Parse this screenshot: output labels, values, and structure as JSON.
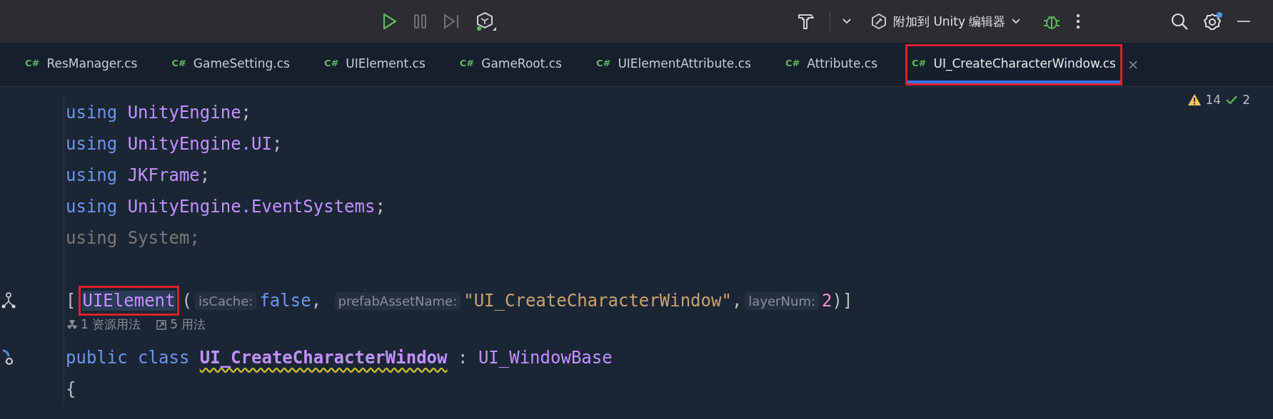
{
  "toolbar": {
    "attach_button": {
      "label": "附加到 Unity 编辑器"
    }
  },
  "tabs": [
    {
      "lang": "C#",
      "label": "ResManager.cs",
      "selected": false,
      "highlighted": false
    },
    {
      "lang": "C#",
      "label": "GameSetting.cs",
      "selected": false,
      "highlighted": false
    },
    {
      "lang": "C#",
      "label": "UIElement.cs",
      "selected": false,
      "highlighted": false
    },
    {
      "lang": "C#",
      "label": "GameRoot.cs",
      "selected": false,
      "highlighted": false
    },
    {
      "lang": "C#",
      "label": "UIElementAttribute.cs",
      "selected": false,
      "highlighted": false
    },
    {
      "lang": "C#",
      "label": "Attribute.cs",
      "selected": false,
      "highlighted": false
    },
    {
      "lang": "C#",
      "label": "UI_CreateCharacterWindow.cs",
      "selected": true,
      "highlighted": true
    }
  ],
  "inspections": {
    "warnings": "14",
    "passed": "2"
  },
  "lines": [
    {
      "kind": "code",
      "tokens": [
        {
          "text": "using",
          "kind": "keyword"
        },
        {
          "text": "UnityEngine",
          "kind": "type",
          "space_before": true
        },
        {
          "text": ";",
          "kind": "plain"
        }
      ]
    },
    {
      "kind": "code",
      "tokens": [
        {
          "text": "using",
          "kind": "keyword"
        },
        {
          "text": "UnityEngine.UI",
          "kind": "type",
          "space_before": true
        },
        {
          "text": ";",
          "kind": "plain"
        }
      ]
    },
    {
      "kind": "code",
      "tokens": [
        {
          "text": "using",
          "kind": "keyword"
        },
        {
          "text": "JKFrame",
          "kind": "type",
          "space_before": true
        },
        {
          "text": ";",
          "kind": "plain"
        }
      ]
    },
    {
      "kind": "code",
      "tokens": [
        {
          "text": "using",
          "kind": "keyword"
        },
        {
          "text": "UnityEngine.EventSystems",
          "kind": "type",
          "space_before": true
        },
        {
          "text": ";",
          "kind": "plain"
        }
      ]
    },
    {
      "kind": "code",
      "tokens": [
        {
          "text": "using System;",
          "kind": "unused"
        }
      ]
    },
    {
      "kind": "blank"
    },
    {
      "kind": "code",
      "gutter_icon": {
        "kind": "hierarchy"
      },
      "tokens": [
        {
          "text": "[",
          "kind": "plain"
        },
        {
          "text": "UIElement",
          "kind": "type",
          "highlighted": true
        },
        {
          "text": "(",
          "kind": "plain"
        },
        {
          "text": "isCache:",
          "kind": "hint"
        },
        {
          "text": "false",
          "kind": "keyword"
        },
        {
          "text": ", ",
          "kind": "plain"
        },
        {
          "text": "prefabAssetName:",
          "kind": "hint"
        },
        {
          "text": "\"UI_CreateCharacterWindow\"",
          "kind": "string"
        },
        {
          "text": ",",
          "kind": "plain"
        },
        {
          "text": "layerNum:",
          "kind": "hint"
        },
        {
          "text": "2",
          "kind": "number"
        },
        {
          "text": ")]",
          "kind": "plain"
        }
      ]
    },
    {
      "kind": "code_vision",
      "items": [
        {
          "kind": "asset_usages",
          "text": "1 资源用法"
        },
        {
          "kind": "usages",
          "text": "5 用法"
        }
      ]
    },
    {
      "kind": "code",
      "gutter_icon": {
        "kind": "implemented"
      },
      "tokens": [
        {
          "text": "public",
          "kind": "keyword"
        },
        {
          "text": "class",
          "kind": "keyword",
          "space_before": true
        },
        {
          "text": "UI_CreateCharacterWindow",
          "kind": "declaration",
          "warning": true,
          "space_before": true
        },
        {
          "text": " : ",
          "kind": "plain"
        },
        {
          "text": "UI_WindowBase",
          "kind": "type"
        }
      ]
    },
    {
      "kind": "code",
      "tokens": [
        {
          "text": "{",
          "kind": "plain"
        }
      ]
    }
  ]
}
